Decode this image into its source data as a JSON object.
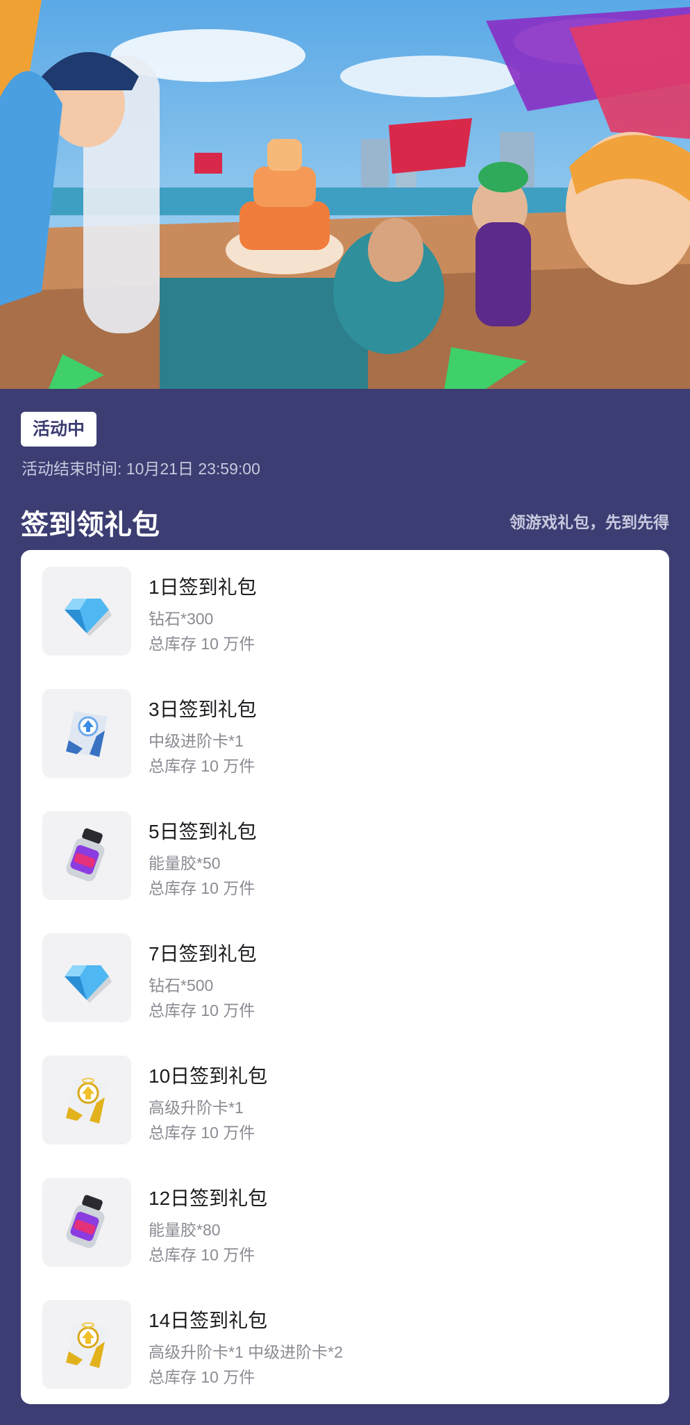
{
  "status": {
    "badge": "活动中",
    "end_time": "活动结束时间: 10月21日 23:59:00"
  },
  "section": {
    "title": "签到领礼包",
    "hint": "领游戏礼包，先到先得"
  },
  "gifts": [
    {
      "title": "1日签到礼包",
      "items": "钻石*300",
      "stock": "总库存 10 万件",
      "icon": "diamond-icon"
    },
    {
      "title": "3日签到礼包",
      "items": "中级进阶卡*1",
      "stock": "总库存 10 万件",
      "icon": "blue-upgrade-card-icon"
    },
    {
      "title": "5日签到礼包",
      "items": "能量胶*50",
      "stock": "总库存 10 万件",
      "icon": "energy-gel-icon"
    },
    {
      "title": "7日签到礼包",
      "items": "钻石*500",
      "stock": "总库存 10 万件",
      "icon": "diamond-icon"
    },
    {
      "title": "10日签到礼包",
      "items": "高级升阶卡*1",
      "stock": "总库存 10 万件",
      "icon": "gold-upgrade-card-icon"
    },
    {
      "title": "12日签到礼包",
      "items": "能量胶*80",
      "stock": "总库存 10 万件",
      "icon": "energy-gel-icon"
    },
    {
      "title": "14日签到礼包",
      "items": "高级升阶卡*1 中级进阶卡*2",
      "stock": "总库存 10 万件",
      "icon": "gold-upgrade-card-icon"
    }
  ],
  "colors": {
    "background": "#3c3d72",
    "card": "#ffffff",
    "thumb": "#f2f2f4"
  }
}
